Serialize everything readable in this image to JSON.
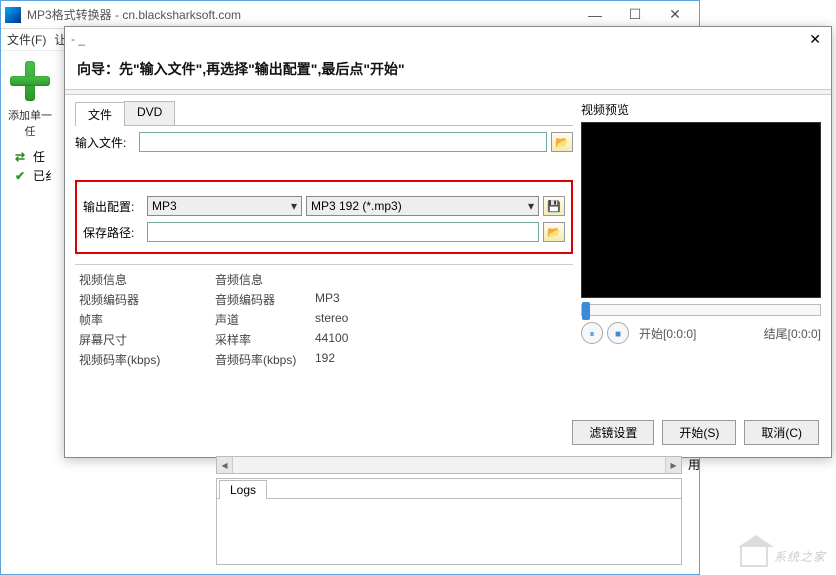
{
  "main_window": {
    "title": "MP3格式转换器 - cn.blacksharksoft.com",
    "menu": {
      "file": "文件(F)",
      "second": "让"
    },
    "toolbar": {
      "add_label": "添加单一任"
    },
    "tree": {
      "item1": "任",
      "item2": "已纟"
    },
    "stray_char": "用"
  },
  "dialog": {
    "title": "- _",
    "heading": "向导：先\"输入文件\",再选择\"输出配置\",最后点\"开始\"",
    "tabs": {
      "file": "文件",
      "dvd": "DVD"
    },
    "input_file_label": "输入文件:",
    "output_config_label": "输出配置:",
    "output_format": "MP3",
    "output_profile": "MP3 192 (*.mp3)",
    "save_path_label": "保存路径:",
    "save_path_value": "",
    "video_info": {
      "title": "视频信息",
      "codec_label": "视频编码器",
      "fps_label": "帧率",
      "size_label": "屏幕尺寸",
      "bitrate_label": "视频码率(kbps)"
    },
    "audio_info": {
      "title": "音频信息",
      "codec_label": "音频编码器",
      "codec_value": "MP3",
      "channel_label": "声道",
      "channel_value": "stereo",
      "sample_label": "采样率",
      "sample_value": "44100",
      "bitrate_label": "音频码率(kbps)",
      "bitrate_value": "192"
    },
    "preview": {
      "label": "视频预览",
      "start_label": "开始",
      "start_time": "[0:0:0]",
      "end_label": "结尾",
      "end_time": "[0:0:0]"
    },
    "buttons": {
      "filter": "滤镜设置",
      "start": "开始(S)",
      "cancel": "取消(C)"
    }
  },
  "logs": {
    "tab": "Logs"
  },
  "watermark": "系统之家"
}
